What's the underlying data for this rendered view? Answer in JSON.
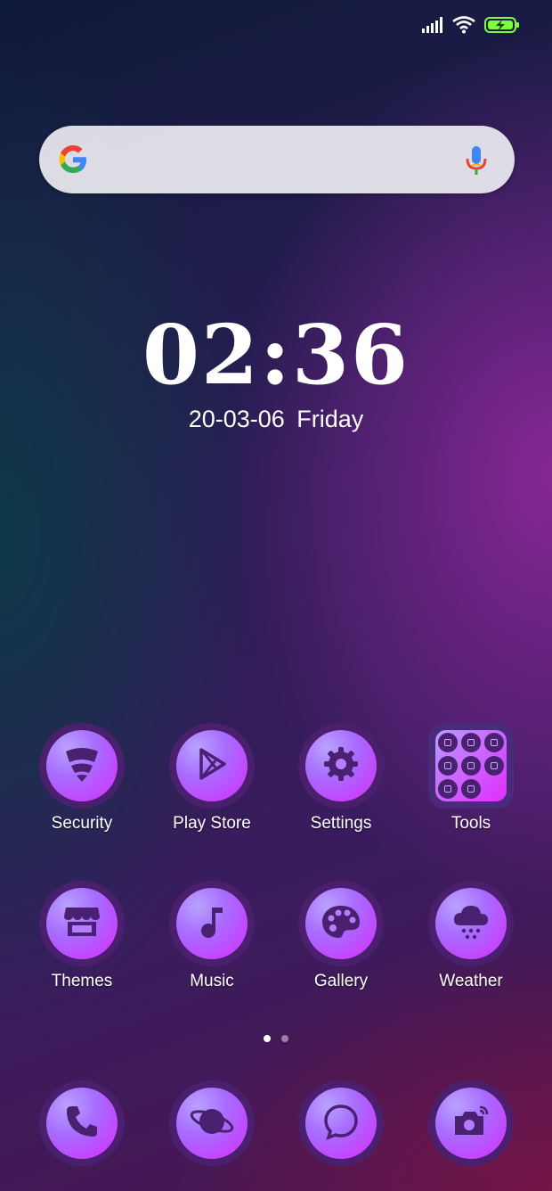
{
  "status_bar": {
    "icons": [
      "signal-icon",
      "wifi-icon",
      "battery-charging-icon"
    ]
  },
  "search_bar": {
    "logo": "google-g-icon",
    "mic": "mic-icon"
  },
  "clock": {
    "time": "02:36",
    "date": "20-03-06  Friday"
  },
  "home_apps": [
    {
      "label": "Security",
      "icon": "shield-icon"
    },
    {
      "label": "Play Store",
      "icon": "play-store-icon"
    },
    {
      "label": "Settings",
      "icon": "gear-icon"
    },
    {
      "label": "Tools",
      "icon": "folder-grid-icon"
    },
    {
      "label": "Themes",
      "icon": "store-icon"
    },
    {
      "label": "Music",
      "icon": "music-note-icon"
    },
    {
      "label": "Gallery",
      "icon": "palette-icon"
    },
    {
      "label": "Weather",
      "icon": "cloud-snow-icon"
    }
  ],
  "page_indicator": {
    "pages": 2,
    "current": 1
  },
  "dock": [
    {
      "icon": "phone-icon"
    },
    {
      "icon": "planet-icon"
    },
    {
      "icon": "chat-bubble-icon"
    },
    {
      "icon": "camera-icon"
    }
  ],
  "colors": {
    "icon_glyph": "#4a2070",
    "icon_ring": "#4a1f6e",
    "battery": "#7cff3a"
  }
}
